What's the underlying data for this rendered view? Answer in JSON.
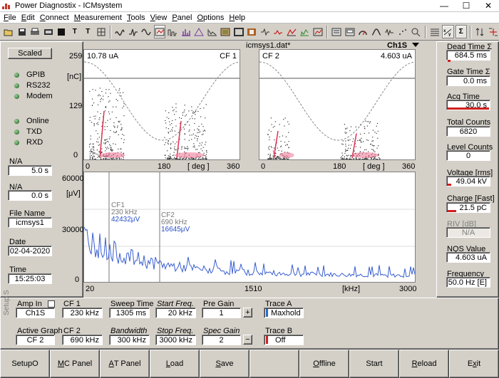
{
  "window": {
    "title": "Power Diagnostix - ICMsystem"
  },
  "menu": [
    {
      "pre": "",
      "u": "F",
      "post": "ile"
    },
    {
      "pre": "",
      "u": "E",
      "post": "dit"
    },
    {
      "pre": "",
      "u": "C",
      "post": "onnect"
    },
    {
      "pre": "",
      "u": "M",
      "post": "easurement"
    },
    {
      "pre": "",
      "u": "T",
      "post": "ools"
    },
    {
      "pre": "",
      "u": "V",
      "post": "iew"
    },
    {
      "pre": "",
      "u": "P",
      "post": "anel"
    },
    {
      "pre": "",
      "u": "O",
      "post": "ptions"
    },
    {
      "pre": "",
      "u": "H",
      "post": "elp"
    }
  ],
  "toolbar": {
    "t1": "T",
    "t2": "T",
    "sigma": "Σ"
  },
  "left": {
    "scaled": "Scaled",
    "leds": [
      "GPIB",
      "RS232",
      "Modem",
      "Online",
      "TXD",
      "RXD"
    ],
    "na1_label": "N/A",
    "na1_value": "5.0 s",
    "na2_label": "N/A",
    "na2_value": "0.0 s",
    "file_label": "File Name",
    "file_value": "icmsys1",
    "date_label": "Date",
    "date_value": "02-04-2020",
    "time_label": "Time",
    "time_value": "15:25:03"
  },
  "center": {
    "file_title": "icmsys1.dat*",
    "channel": "Ch1S",
    "prpd": {
      "y_max": "259",
      "y_mid": "129",
      "y_min": "0",
      "y_unit": "[nC]",
      "x_ticks": [
        "0",
        "180",
        "360"
      ],
      "x_unit": "[ deg ]",
      "left_value": "10.78 uA",
      "left_label": "CF 1",
      "right_label": "CF 2",
      "right_value": "4.603 uA"
    },
    "spectrum": {
      "y_ticks": [
        "60000",
        "30000",
        "0"
      ],
      "y_unit": "[μV]",
      "x_ticks": [
        "20",
        "1510",
        "3000"
      ],
      "x_unit": "[kHz]",
      "m1": [
        "CF1",
        "230 kHz",
        "42432μV"
      ],
      "m2": [
        "CF2",
        "690 kHz",
        "16645μV"
      ]
    }
  },
  "right": {
    "dead_time_label": "Dead Time Σ",
    "dead_time_value": "684.5 ms",
    "gate_time_label": "Gate Time Σ",
    "gate_time_value": "0.0 ms",
    "acq_time_label": "Acq Time",
    "acq_time_value": "30.0 s",
    "total_counts_label": "Total Counts",
    "total_counts_value": "6820",
    "level_counts_label": "Level Counts",
    "level_counts_value": "0",
    "voltage_label": "Voltage [rms]",
    "voltage_value": "49.04 kV",
    "charge_label": "Charge [Fast]",
    "charge_value": "21.5 pC",
    "riv_label": "RIV [dB]",
    "riv_value": "N/A",
    "nqs_label": "NQS Value",
    "nqs_value": "4.603 uA",
    "freq_label": "Frequency",
    "freq_value": "50.0 Hz [E]"
  },
  "setup": {
    "side_label": "Setup S",
    "amp_in_label": "Amp In",
    "amp_in_value": "Ch1S",
    "active_graph_label": "Active Graph",
    "active_graph_value": "CF 2",
    "cf1_label": "CF 1",
    "cf1_value": "230 kHz",
    "cf2_label": "CF 2",
    "cf2_value": "690 kHz",
    "sweep_label": "Sweep Time",
    "sweep_value": "1305 ms",
    "bandwidth_label": "Bandwidth",
    "bandwidth_value": "300 kHz",
    "start_label": "Start Freq.",
    "start_value": "20 kHz",
    "stop_label": "Stop Freq.",
    "stop_value": "3000 kHz",
    "pregain_label": "Pre Gain",
    "pregain_value": "1",
    "plus": "+",
    "specgain_label": "Spec Gain",
    "specgain_value": "2",
    "minus": "−",
    "trace_a_label": "Trace A",
    "trace_a_value": "Maxhold",
    "trace_b_label": "Trace B",
    "trace_b_value": "Off"
  },
  "buttons": [
    {
      "pre": "Setup ",
      "u": "",
      "post": "O",
      "name": "setup-o-button"
    },
    {
      "pre": "",
      "u": "M",
      "post": "C Panel",
      "name": "mc-panel-button"
    },
    {
      "pre": "",
      "u": "A",
      "post": "T Panel",
      "name": "at-panel-button"
    },
    {
      "pre": "",
      "u": "L",
      "post": "oad",
      "name": "load-button"
    },
    {
      "pre": "",
      "u": "S",
      "post": "ave",
      "name": "save-button"
    },
    {
      "pre": "",
      "u": "",
      "post": "",
      "name": "empty-button"
    },
    {
      "pre": "",
      "u": "O",
      "post": "ffline",
      "name": "offline-button"
    },
    {
      "pre": "",
      "u": "",
      "post": "Start",
      "name": "start-button"
    },
    {
      "pre": "",
      "u": "R",
      "post": "eload",
      "name": "reload-button"
    },
    {
      "pre": "E",
      "u": "x",
      "post": "it",
      "name": "exit-button"
    }
  ]
}
